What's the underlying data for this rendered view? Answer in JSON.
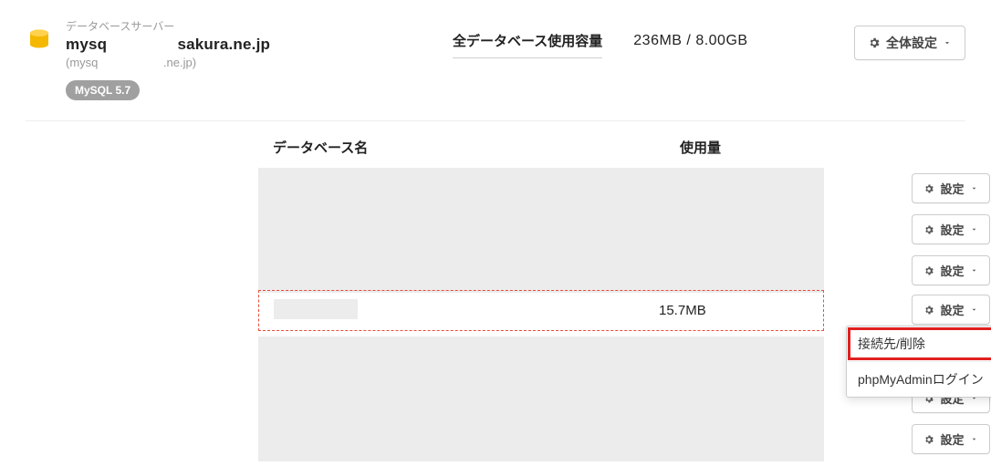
{
  "server": {
    "label": "データベースサーバー",
    "host_prefix": "mysq",
    "host_suffix": "sakura.ne.jp",
    "sub_prefix": "(mysq",
    "sub_suffix": ".ne.jp)",
    "version": "MySQL 5.7"
  },
  "usage": {
    "label": "全データベース使用容量",
    "used": "236MB",
    "sep": " / ",
    "total": "8.00GB"
  },
  "buttons": {
    "global_settings": "全体設定",
    "row_settings": "設定"
  },
  "table": {
    "head_name": "データベース名",
    "head_usage": "使用量",
    "rows": [
      {
        "name": "",
        "usage": ""
      },
      {
        "name": "",
        "usage": ""
      },
      {
        "name": "",
        "usage": ""
      },
      {
        "name": "",
        "usage": "15.7MB",
        "highlight": true
      },
      {
        "name": "",
        "usage": ""
      },
      {
        "name": "",
        "usage": ""
      },
      {
        "name": "",
        "usage": ""
      }
    ]
  },
  "dropdown": {
    "connect_delete": "接続先/削除",
    "phpmyadmin": "phpMyAdminログイン"
  }
}
